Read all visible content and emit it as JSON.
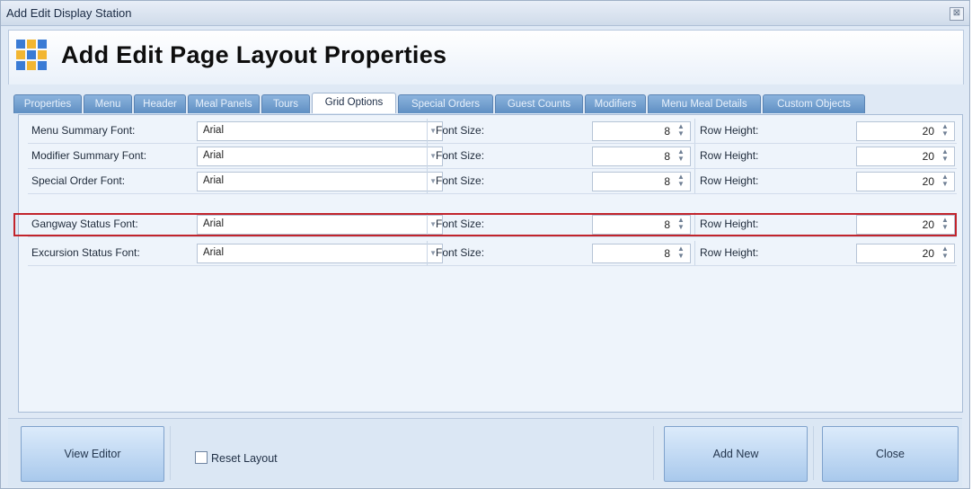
{
  "window": {
    "title": "Add Edit Display Station",
    "close_glyph": "⊠"
  },
  "header": {
    "title": "Add Edit Page Layout Properties"
  },
  "tabs": [
    {
      "label": "Properties"
    },
    {
      "label": "Menu"
    },
    {
      "label": "Header"
    },
    {
      "label": "Meal Panels"
    },
    {
      "label": "Tours"
    },
    {
      "label": "Grid Options",
      "active": true
    },
    {
      "label": "Special Orders"
    },
    {
      "label": "Guest Counts"
    },
    {
      "label": "Modifiers"
    },
    {
      "label": "Menu Meal Details"
    },
    {
      "label": "Custom Objects"
    }
  ],
  "grid": {
    "font_size_label": "Font Size:",
    "row_height_label": "Row Height:",
    "rows": [
      {
        "label": "Menu Summary Font:",
        "font": "Arial",
        "font_size": "8",
        "row_height": "20"
      },
      {
        "label": "Modifier Summary Font:",
        "font": "Arial",
        "font_size": "8",
        "row_height": "20"
      },
      {
        "label": "Special Order Font:",
        "font": "Arial",
        "font_size": "8",
        "row_height": "20"
      },
      {
        "label": "Gangway Status Font:",
        "font": "Arial",
        "font_size": "8",
        "row_height": "20",
        "highlighted": true
      },
      {
        "label": "Excursion Status Font:",
        "font": "Arial",
        "font_size": "8",
        "row_height": "20"
      }
    ]
  },
  "footer": {
    "view_editor": "View Editor",
    "reset_layout": "Reset Layout",
    "add_new": "Add New",
    "close": "Close"
  },
  "colors": {
    "highlight": "#c2242c",
    "tab": "#6f9bcc",
    "accent": "#a9c9ec"
  }
}
